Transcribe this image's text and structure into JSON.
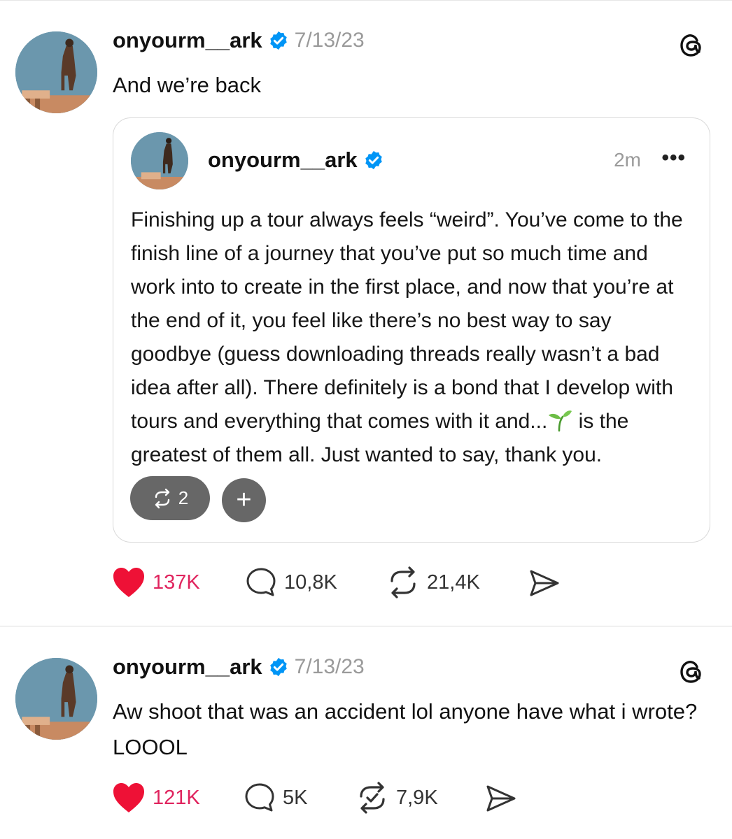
{
  "posts": [
    {
      "handle": "onyourm__ark",
      "date": "7/13/23",
      "text": "And we’re back",
      "quote": {
        "handle": "onyourm__ark",
        "time": "2m",
        "more": "•••",
        "text_before": "Finishing up a tour always feels “weird”. You’ve come to the finish line of a journey that you’ve put so much time and work into to create in the first place, and now that you’re at the end of it, you feel like there’s no best way to say goodbye (guess downloading threads really wasn’t a bad idea after all). There definitely is a bond that I develop with tours and everything that comes with it and...",
        "text_after": " is the greatest of them all. Just wanted to say, thank you.",
        "repost_pill_count": "2",
        "plus_label": "+"
      },
      "actions": {
        "likes": "137K",
        "comments": "10,8K",
        "reposts": "21,4K"
      }
    },
    {
      "handle": "onyourm__ark",
      "date": "7/13/23",
      "text": "Aw shoot that was an accident lol anyone have what i wrote? LOOOL",
      "actions": {
        "likes": "121K",
        "comments": "5K",
        "reposts": "7,9K"
      }
    }
  ],
  "colors": {
    "like": "#e0245e",
    "verified": "#0095f6",
    "muted": "#9a9a9a"
  },
  "icons": [
    "threads-logo-icon",
    "verified-badge-icon",
    "heart-icon",
    "comment-icon",
    "repost-icon",
    "share-icon",
    "more-icon",
    "sprout-emoji"
  ]
}
